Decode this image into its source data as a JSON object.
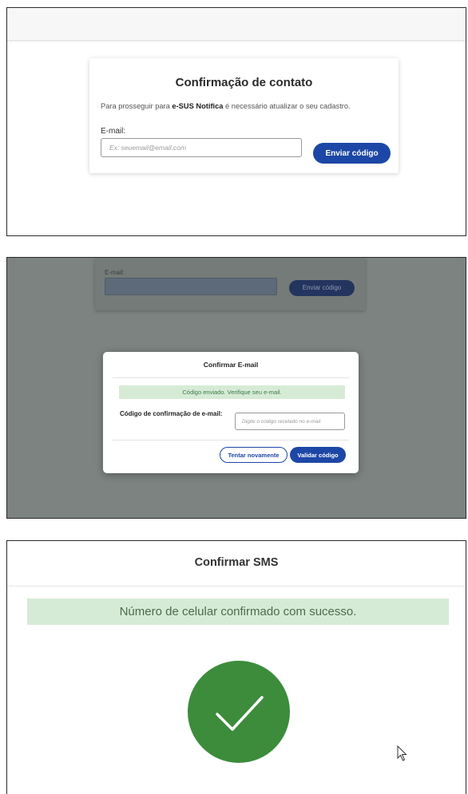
{
  "panel1": {
    "title": "Confirmação de contato",
    "desc_prefix": "Para prosseguir para ",
    "desc_app": "e-SUS Notifica",
    "desc_suffix": " é necessário atualizar o seu cadastro.",
    "email_label": "E-mail:",
    "email_placeholder": "Ex: seuemail@email.com",
    "email_value": "",
    "send_button": "Enviar código"
  },
  "panel2": {
    "background": {
      "email_label": "E-mail:",
      "send_button": "Enviar código"
    },
    "modal": {
      "title": "Confirmar E-mail",
      "alert": "Código enviado. Verifique seu e-mail.",
      "code_label": "Código de confirmação de e-mail:",
      "code_placeholder": "Digite o código recebido no e-mail",
      "retry_button": "Tentar novamente",
      "validate_button": "Validar código"
    }
  },
  "panel3": {
    "title": "Confirmar SMS",
    "alert": "Número de celular confirmado com sucesso.",
    "icon": "checkmark-circle-icon"
  },
  "colors": {
    "primary": "#1d47a6",
    "success_bg": "#d6ebd6",
    "success_icon": "#3c8c3c",
    "overlay": "#7c8381"
  }
}
